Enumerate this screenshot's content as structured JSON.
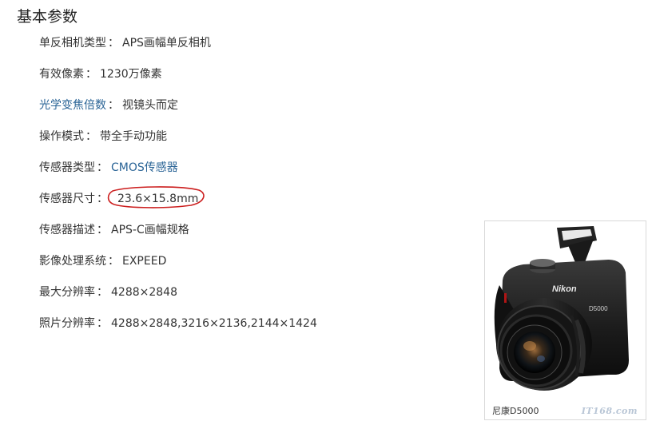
{
  "section": {
    "title": "基本参数"
  },
  "params": [
    {
      "label": "单反相机类型",
      "value": "APS画幅单反相机"
    },
    {
      "label": "有效像素",
      "value": "1230万像素"
    },
    {
      "label": "光学变焦倍数",
      "value": "视镜头而定"
    },
    {
      "label": "操作模式",
      "value": "带全手动功能"
    },
    {
      "label": "传感器类型",
      "value": "CMOS传感器"
    },
    {
      "label": "传感器尺寸",
      "value": "23.6×15.8mm"
    },
    {
      "label": "传感器描述",
      "value": "APS-C画幅规格"
    },
    {
      "label": "影像处理系统",
      "value": "EXPEED"
    },
    {
      "label": "最大分辨率",
      "value": "4288×2848"
    },
    {
      "label": "照片分辨率",
      "value": "4288×2848,3216×2136,2144×1424"
    }
  ],
  "separator": "：",
  "photo": {
    "caption": "尼康D5000",
    "brand_on_body": "Nikon",
    "model_on_body": "D5000",
    "watermark": "IT168.com"
  },
  "colors": {
    "link": "#2a6496",
    "text": "#333333",
    "annotation": "#cc1f1f"
  }
}
